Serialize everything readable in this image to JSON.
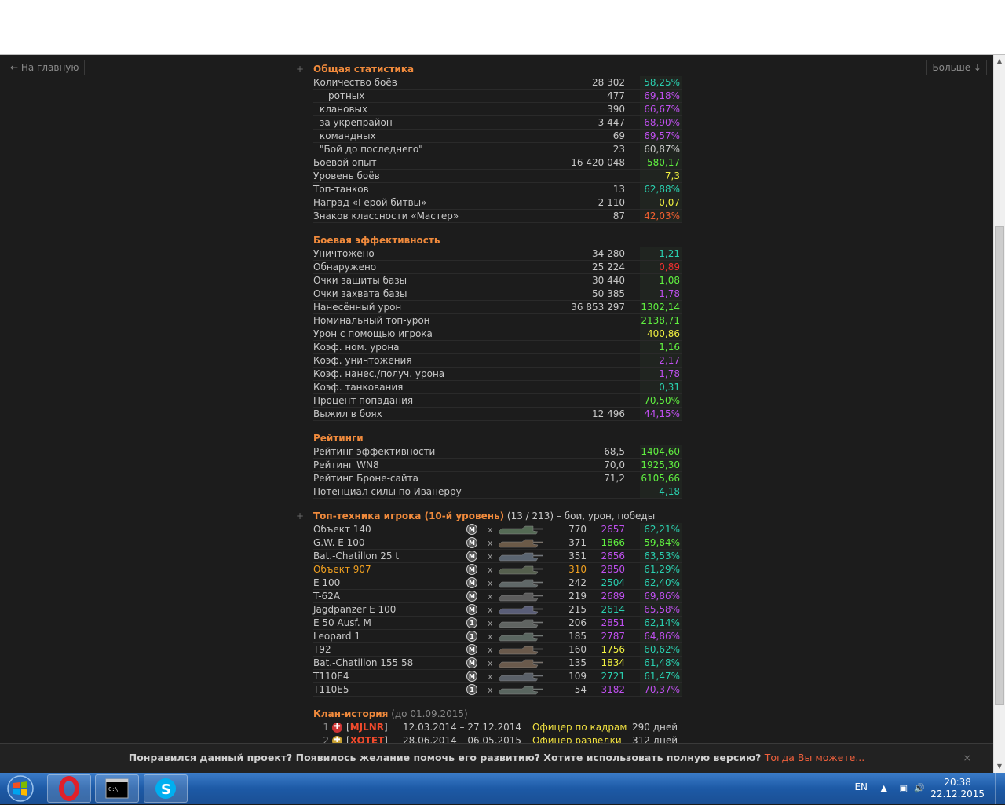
{
  "nav": {
    "back_label": "← На главную",
    "more_label": "Больше ↓"
  },
  "sections": {
    "general": {
      "title": "Общая статистика",
      "rows": [
        {
          "label": "Количество боёв",
          "v1": "28 302",
          "v2": "58,25%",
          "color": "#2ad0b0",
          "indent": 0
        },
        {
          "label": "ротных",
          "v1": "477",
          "v2": "69,18%",
          "color": "#c050f0",
          "indent": 1
        },
        {
          "label": "клановых",
          "v1": "390",
          "v2": "66,67%",
          "color": "#c050f0",
          "indent": 2
        },
        {
          "label": "за укрепрайон",
          "v1": "3 447",
          "v2": "68,90%",
          "color": "#c050f0",
          "indent": 2
        },
        {
          "label": "командных",
          "v1": "69",
          "v2": "69,57%",
          "color": "#c050f0",
          "indent": 2
        },
        {
          "label": "\"Бой до последнего\"",
          "v1": "23",
          "v2": "60,87%",
          "color": "#c8c8c8",
          "indent": 2
        },
        {
          "label": "Боевой опыт",
          "v1": "16 420 048",
          "v2": "580,17",
          "color": "#60f040",
          "indent": 0
        },
        {
          "label": "Уровень боёв",
          "v1": "",
          "v2": "7,3",
          "color": "#f0f040",
          "indent": 0
        },
        {
          "label": "Топ-танков",
          "v1": "13",
          "v2": "62,88%",
          "color": "#2ad0b0",
          "indent": 0
        },
        {
          "label": "Наград «Герой битвы»",
          "v1": "2 110",
          "v2": "0,07",
          "color": "#f0f040",
          "indent": 0
        },
        {
          "label": "Знаков классности «Мастер»",
          "v1": "87",
          "v2": "42,03%",
          "color": "#f06030",
          "indent": 0
        }
      ]
    },
    "efficiency": {
      "title": "Боевая эффективность",
      "rows": [
        {
          "label": "Уничтожено",
          "v1": "34 280",
          "v2": "1,21",
          "color": "#2ad0b0"
        },
        {
          "label": "Обнаружено",
          "v1": "25 224",
          "v2": "0,89",
          "color": "#f03030"
        },
        {
          "label": "Очки защиты базы",
          "v1": "30 440",
          "v2": "1,08",
          "color": "#60f040"
        },
        {
          "label": "Очки захвата базы",
          "v1": "50 385",
          "v2": "1,78",
          "color": "#c050f0"
        },
        {
          "label": "Нанесённый урон",
          "v1": "36 853 297",
          "v2": "1302,14",
          "color": "#60f040"
        },
        {
          "label": "Номинальный топ-урон",
          "v1": "",
          "v2": "2138,71",
          "color": "#60f040"
        },
        {
          "label": "Урон с помощью игрока",
          "v1": "",
          "v2": "400,86",
          "color": "#f0f040"
        },
        {
          "label": "Коэф. ном. урона",
          "v1": "",
          "v2": "1,16",
          "color": "#60f040"
        },
        {
          "label": "Коэф. уничтожения",
          "v1": "",
          "v2": "2,17",
          "color": "#c050f0"
        },
        {
          "label": "Коэф. нанес./получ. урона",
          "v1": "",
          "v2": "1,78",
          "color": "#c050f0"
        },
        {
          "label": "Коэф. танкования",
          "v1": "",
          "v2": "0,31",
          "color": "#2ad0b0"
        },
        {
          "label": "Процент попадания",
          "v1": "",
          "v2": "70,50%",
          "color": "#60f040"
        },
        {
          "label": "Выжил в боях",
          "v1": "12 496",
          "v2": "44,15%",
          "color": "#c050f0"
        }
      ]
    },
    "ratings": {
      "title": "Рейтинги",
      "rows": [
        {
          "label": "Рейтинг эффективности",
          "v1": "68,5",
          "v2": "1404,60",
          "color": "#60f040"
        },
        {
          "label": "Рейтинг WN8",
          "v1": "70,0",
          "v2": "1925,30",
          "color": "#60f040"
        },
        {
          "label": "Рейтинг Броне-сайта",
          "v1": "71,2",
          "v2": "6105,66",
          "color": "#60f040"
        },
        {
          "label": "Потенциал силы по Иванерру",
          "v1": "",
          "v2": "4,18",
          "color": "#2ad0b0"
        }
      ]
    },
    "tanks": {
      "title": "Топ-техника игрока (10-й уровень)",
      "subtitle": " (13 / 213) – бои, урон, победы",
      "rows": [
        {
          "name": "Объект 140",
          "badge": "M",
          "battles": "770",
          "damage": "2657",
          "dmg_color": "#c050f0",
          "win": "62,21%",
          "win_color": "#2ad0b0",
          "hl": false
        },
        {
          "name": "G.W. E 100",
          "badge": "M",
          "battles": "371",
          "damage": "1866",
          "dmg_color": "#60f040",
          "win": "59,84%",
          "win_color": "#60f040",
          "hl": false
        },
        {
          "name": "Bat.-Chatillon 25 t",
          "badge": "M",
          "battles": "351",
          "damage": "2656",
          "dmg_color": "#c050f0",
          "win": "63,53%",
          "win_color": "#2ad0b0",
          "hl": false
        },
        {
          "name": "Объект 907",
          "badge": "M",
          "battles": "310",
          "damage": "2850",
          "dmg_color": "#c050f0",
          "win": "61,29%",
          "win_color": "#2ad0b0",
          "hl": true
        },
        {
          "name": "E 100",
          "badge": "M",
          "battles": "242",
          "damage": "2504",
          "dmg_color": "#2ad0b0",
          "win": "62,40%",
          "win_color": "#2ad0b0",
          "hl": false
        },
        {
          "name": "T-62A",
          "badge": "M",
          "battles": "219",
          "damage": "2689",
          "dmg_color": "#c050f0",
          "win": "69,86%",
          "win_color": "#c050f0",
          "hl": false
        },
        {
          "name": "Jagdpanzer E 100",
          "badge": "M",
          "battles": "215",
          "damage": "2614",
          "dmg_color": "#2ad0b0",
          "win": "65,58%",
          "win_color": "#c050f0",
          "hl": false
        },
        {
          "name": "E 50 Ausf. M",
          "badge": "1",
          "battles": "206",
          "damage": "2851",
          "dmg_color": "#c050f0",
          "win": "62,14%",
          "win_color": "#2ad0b0",
          "hl": false
        },
        {
          "name": "Leopard 1",
          "badge": "1",
          "battles": "185",
          "damage": "2787",
          "dmg_color": "#c050f0",
          "win": "64,86%",
          "win_color": "#c050f0",
          "hl": false
        },
        {
          "name": "T92",
          "badge": "M",
          "battles": "160",
          "damage": "1756",
          "dmg_color": "#f0f040",
          "win": "60,62%",
          "win_color": "#2ad0b0",
          "hl": false
        },
        {
          "name": "Bat.-Chatillon 155 58",
          "badge": "M",
          "battles": "135",
          "damage": "1834",
          "dmg_color": "#f0f040",
          "win": "61,48%",
          "win_color": "#2ad0b0",
          "hl": false
        },
        {
          "name": "T110E4",
          "badge": "M",
          "battles": "109",
          "damage": "2721",
          "dmg_color": "#2ad0b0",
          "win": "61,47%",
          "win_color": "#2ad0b0",
          "hl": false
        },
        {
          "name": "T110E5",
          "badge": "1",
          "battles": "54",
          "damage": "3182",
          "dmg_color": "#c050f0",
          "win": "70,37%",
          "win_color": "#c050f0",
          "hl": false
        }
      ],
      "x_mark": "x"
    },
    "clan": {
      "title": "Клан-история",
      "subtitle": " (до 01.09.2015)",
      "rows": [
        {
          "num": "1",
          "tag": "MJLNR",
          "dates": "12.03.2014 – 27.12.2014",
          "role": "Офицер по кадрам",
          "days": "290 дней"
        },
        {
          "num": "2",
          "tag": "XOTET",
          "dates": "28.06.2014 – 06.05.2015",
          "role": "Офицер разведки",
          "days": "312 дней"
        }
      ]
    }
  },
  "banner": {
    "text": "Понравился данный проект? Появилось желание помочь его развитию? Хотите использовать полную версию? ",
    "link": "Тогда Вы можете...",
    "close": "×"
  },
  "taskbar": {
    "lang": "EN",
    "time": "20:38",
    "date": "22.12.2015"
  }
}
